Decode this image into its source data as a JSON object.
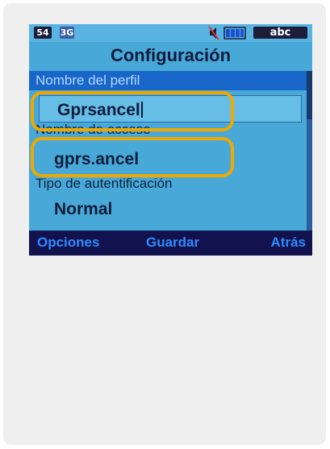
{
  "status": {
    "signal": "54",
    "network": "3G",
    "mode": "abc"
  },
  "title": "Configuración",
  "fields": {
    "profile_label": "Nombre del perfil",
    "profile_value": "Gprsancel",
    "access_label": "Nombre de acceso",
    "access_value": "gprs.ancel",
    "auth_label": "Tipo de autentificación",
    "auth_value": "Normal"
  },
  "softkeys": {
    "left": "Opciones",
    "center": "Guardar",
    "right": "Atrás"
  },
  "colors": {
    "highlight": "#f0a800",
    "selection": "#1866c7",
    "screen": "#48a9d8",
    "softbar": "#12124e"
  },
  "icons": [
    "signal-icon",
    "network-3g-icon",
    "silent-mode-icon",
    "battery-icon"
  ]
}
